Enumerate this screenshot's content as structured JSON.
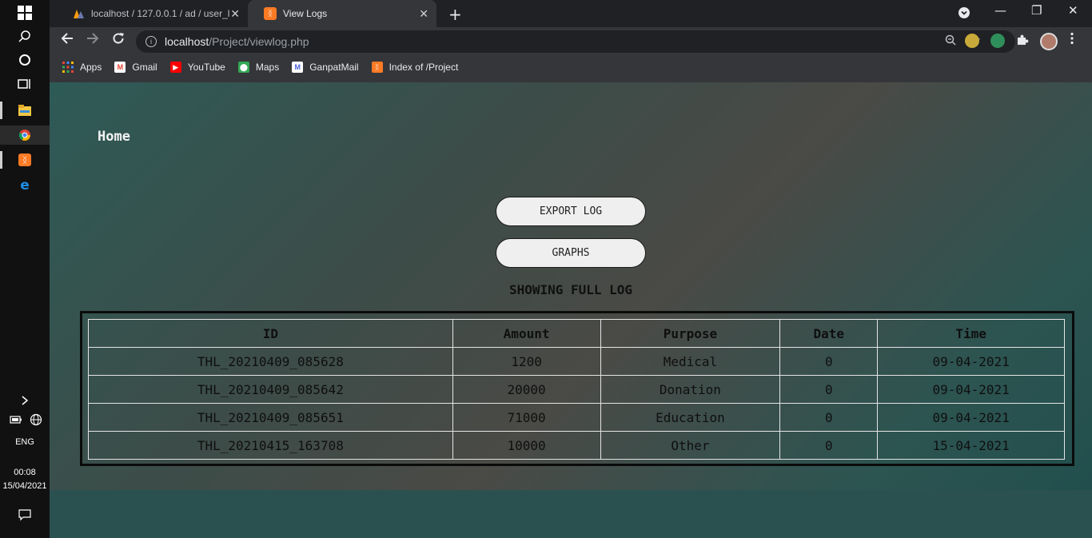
{
  "taskbar": {
    "language": "ENG",
    "time": "00:08",
    "date": "15/04/2021"
  },
  "browser": {
    "tabs": [
      {
        "title": "localhost / 127.0.0.1 / ad / user_l",
        "active": false
      },
      {
        "title": "View Logs",
        "active": true
      }
    ],
    "url_host": "localhost",
    "url_path": "/Project/viewlog.php",
    "bookmarks": [
      "Apps",
      "Gmail",
      "YouTube",
      "Maps",
      "GanpatMail",
      "Index of /Project"
    ]
  },
  "page": {
    "home_link": "Home",
    "export_button": "EXPORT LOG",
    "graphs_button": "GRAPHS",
    "heading": "SHOWING FULL LOG",
    "table": {
      "headers": [
        "ID",
        "Amount",
        "Purpose",
        "Date",
        "Time"
      ],
      "rows": [
        [
          "THL_20210409_085628",
          "1200",
          "Medical",
          "0",
          "09-04-2021"
        ],
        [
          "THL_20210409_085642",
          "20000",
          "Donation",
          "0",
          "09-04-2021"
        ],
        [
          "THL_20210409_085651",
          "71000",
          "Education",
          "0",
          "09-04-2021"
        ],
        [
          "THL_20210415_163708",
          "10000",
          "Other",
          "0",
          "15-04-2021"
        ]
      ]
    }
  },
  "colors": {
    "page_gradient_start": "#2e5a56",
    "page_gradient_mid": "#4a4a46",
    "button_bg": "#efefef",
    "table_border": "#e5e5e5"
  }
}
